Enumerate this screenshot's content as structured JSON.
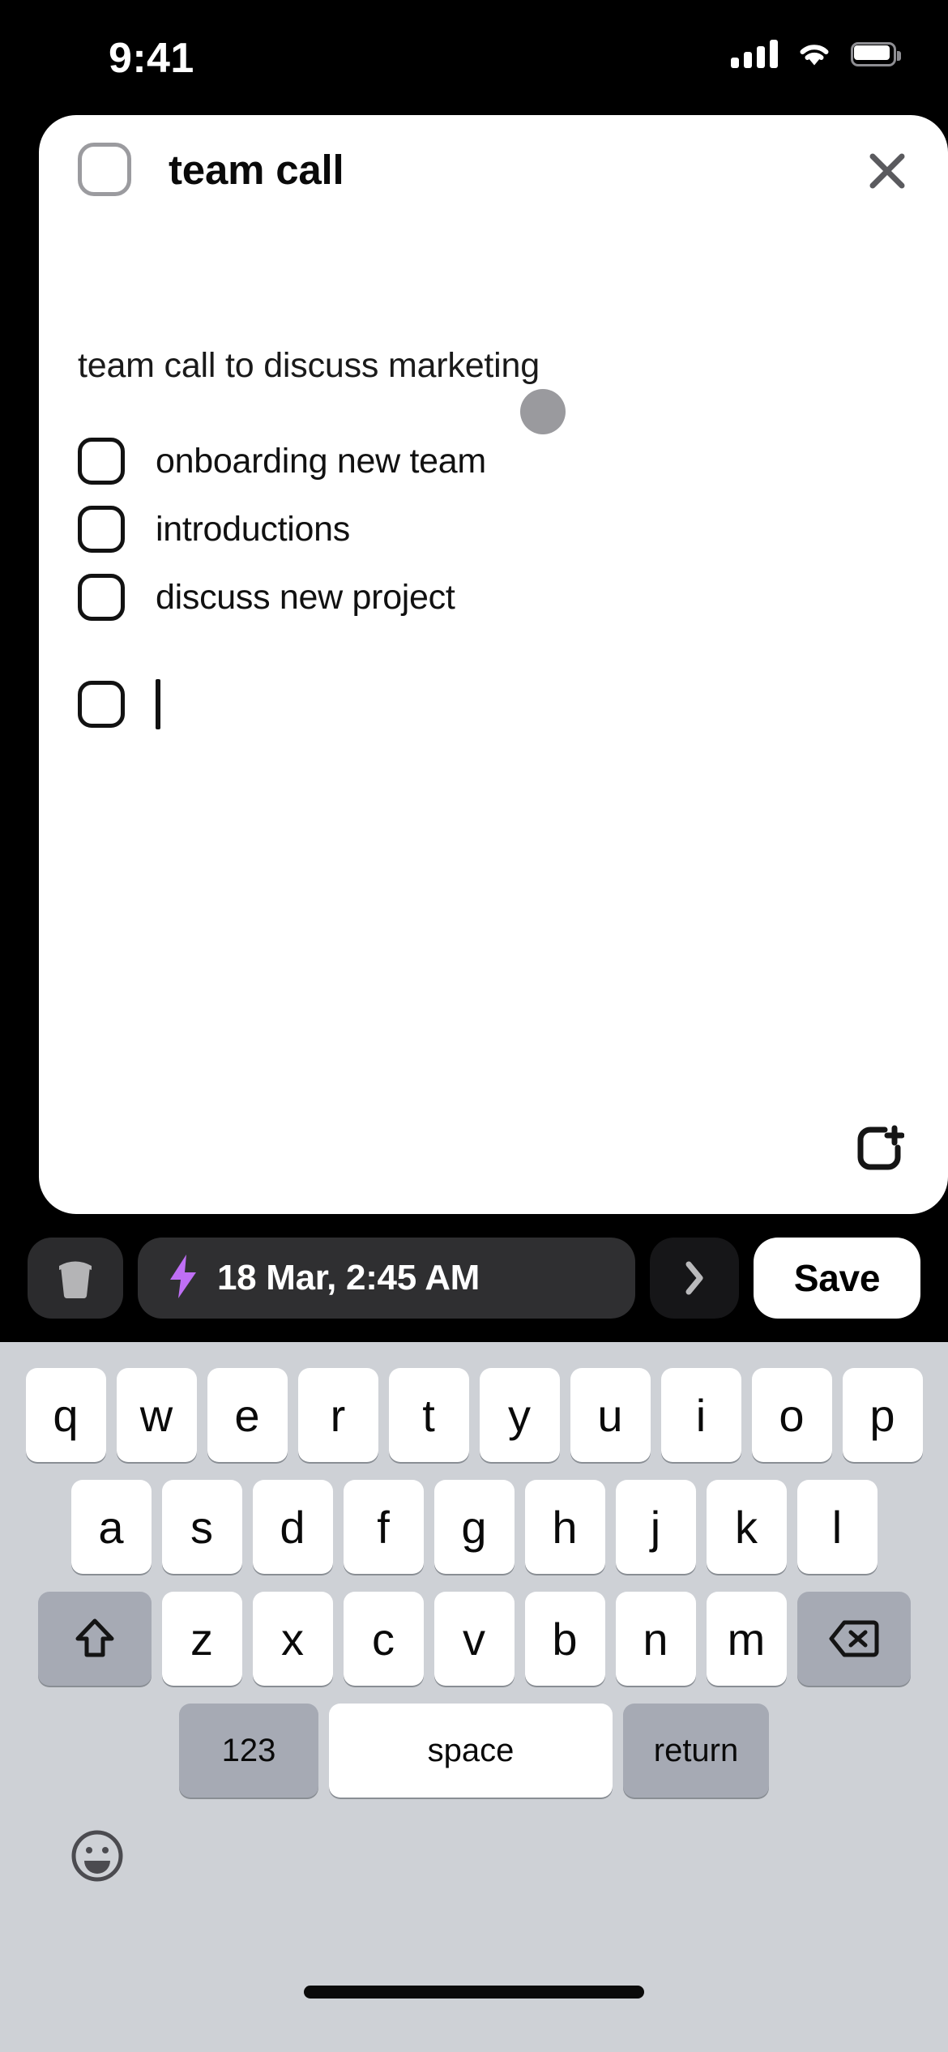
{
  "status_bar": {
    "time": "9:41",
    "cellular_icon": "cellular-signal-icon",
    "wifi_icon": "wifi-icon",
    "battery_icon": "battery-icon"
  },
  "note_card": {
    "title": "team call",
    "title_checkbox": "unchecked",
    "close_icon": "close-icon",
    "description": "team call to discuss marketing",
    "checklist": [
      {
        "label": "onboarding new team",
        "checked": false
      },
      {
        "label": "introductions",
        "checked": false
      },
      {
        "label": "discuss new project",
        "checked": false
      },
      {
        "label": "",
        "checked": false,
        "editing": true
      }
    ],
    "add_item_icon": "add-checklist-item-icon",
    "touch_indicator": "touch-indicator"
  },
  "toolbar": {
    "trash_icon": "trash-icon",
    "reminder_icon": "lightning-bolt-icon",
    "reminder_date": "18 Mar, 2:45 AM",
    "chevron_icon": "chevron-right-icon",
    "save_label": "Save"
  },
  "keyboard": {
    "row1": [
      "q",
      "w",
      "e",
      "r",
      "t",
      "y",
      "u",
      "i",
      "o",
      "p"
    ],
    "row2": [
      "a",
      "s",
      "d",
      "f",
      "g",
      "h",
      "j",
      "k",
      "l"
    ],
    "row3": [
      "z",
      "x",
      "c",
      "v",
      "b",
      "n",
      "m"
    ],
    "shift_icon": "shift-icon",
    "backspace_icon": "backspace-icon",
    "numbers_label": "123",
    "space_label": "space",
    "return_label": "return",
    "emoji_icon": "emoji-icon"
  },
  "colors": {
    "accent_purple": "#bf6ff5",
    "keyboard_bg": "#ced1d6",
    "key_gray": "#a6aab4",
    "toolbar_dark": "#2f2f31"
  }
}
